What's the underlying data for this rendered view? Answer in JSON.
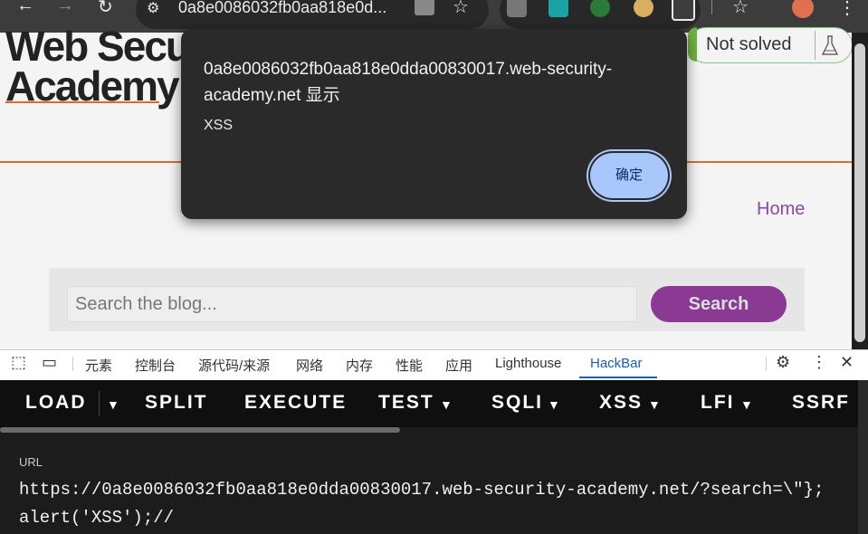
{
  "browser": {
    "url": "0a8e0086032fb0aa818e0d...",
    "back_icon": "←",
    "forward_icon": "→",
    "reload_icon": "↻"
  },
  "page": {
    "logo_line1": "Web Secur",
    "logo_line2": "Academy",
    "status_label": "Not solved",
    "home_link": "Home",
    "search_placeholder": "Search the blog...",
    "search_button": "Search"
  },
  "dialog": {
    "title": "0a8e0086032fb0aa818e0dda00830017.web-security-academy.net 显示",
    "message": "XSS",
    "ok_label": "确定"
  },
  "devtools": {
    "tabs": [
      "元素",
      "控制台",
      "源代码/来源",
      "网络",
      "内存",
      "性能",
      "应用",
      "Lighthouse",
      "HackBar"
    ]
  },
  "hackbar": {
    "load": "LOAD",
    "split": "SPLIT",
    "execute": "EXECUTE",
    "test": "TEST",
    "sqli": "SQLI",
    "xss": "XSS",
    "lfi": "LFI",
    "ssrf": "SSRF",
    "url_label": "URL",
    "url_value": "https://0a8e0086032fb0aa818e0dda00830017.web-security-academy.net/?search=\\\"}; alert('XSS');//"
  },
  "colors": {
    "accent_orange": "#e06a2c",
    "hackbar_active": "#1a5fb4",
    "dialog_ok": "#a8c7fa"
  }
}
